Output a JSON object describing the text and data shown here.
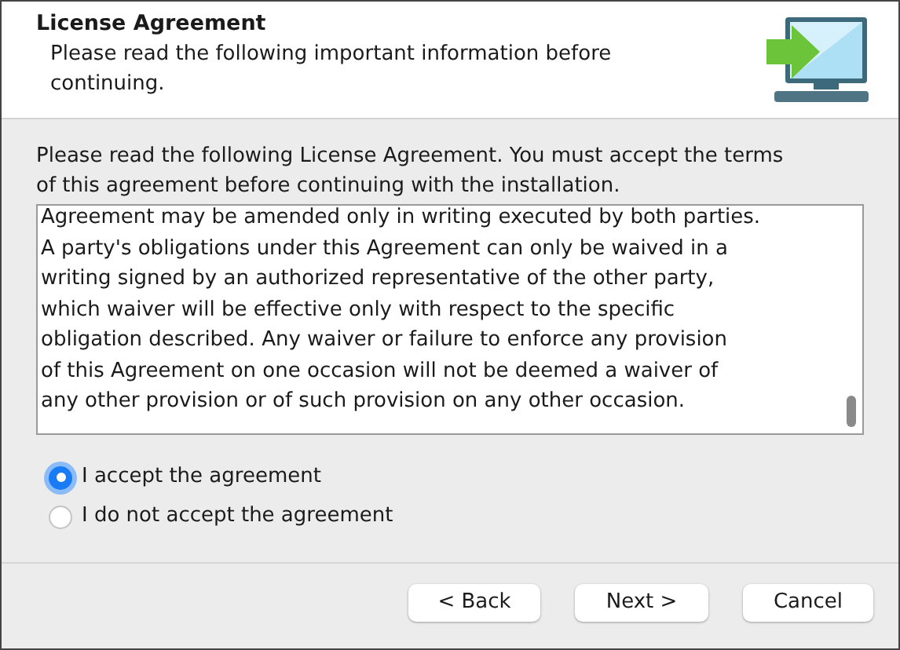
{
  "header": {
    "title": "License Agreement",
    "subtitle_lines": [
      "Please read the following important information before",
      "continuing."
    ]
  },
  "instructions_lines": [
    "Please read the following License Agreement. You must accept the terms",
    "of this agreement before continuing with the installation."
  ],
  "license_text": {
    "lines": [
      "Agreement may be amended only in writing executed by both parties.",
      "A party's obligations under this Agreement can only be waived in a",
      "writing signed by an authorized representative of the other party,",
      "which waiver will be effective only with respect to the specific",
      "obligation described. Any waiver or failure to enforce any provision",
      "of this Agreement on one occasion will not be deemed a waiver of",
      "any other provision or of such provision on any other occasion."
    ]
  },
  "options": [
    {
      "label": "I accept the agreement",
      "selected": true
    },
    {
      "label": "I do not accept the agreement",
      "selected": false
    }
  ],
  "buttons": [
    {
      "label": "< Back",
      "kind": "back"
    },
    {
      "label": "Next >",
      "kind": "next"
    },
    {
      "label": "Cancel",
      "kind": "cancel"
    }
  ]
}
